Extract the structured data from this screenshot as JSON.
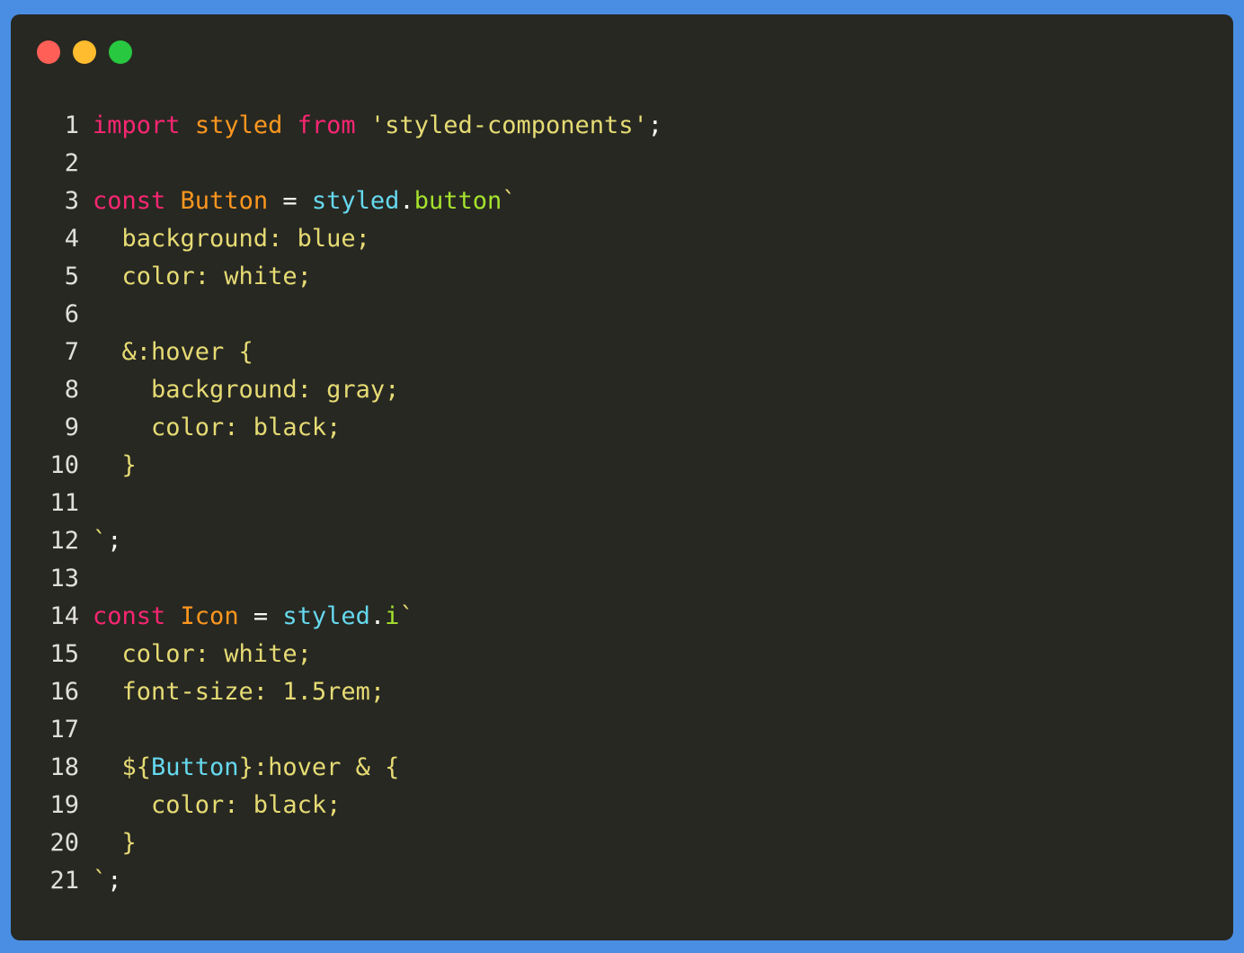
{
  "window": {
    "controls": [
      {
        "name": "close-dot",
        "color": "#ff5f57"
      },
      {
        "name": "minimize-dot",
        "color": "#febc2e"
      },
      {
        "name": "maximize-dot",
        "color": "#28c840"
      }
    ]
  },
  "colors": {
    "background": "#272822",
    "frame": "#4a8ee3",
    "keyword": "#f92672",
    "identifier": "#fd971f",
    "string": "#e6db74",
    "tag": "#66d9ef",
    "function": "#a6e22e",
    "plain": "#f8f8f2"
  },
  "code": {
    "lines": [
      {
        "num": "1",
        "tokens": [
          {
            "t": "import",
            "c": "kw"
          },
          {
            "t": " ",
            "c": "pl"
          },
          {
            "t": "styled",
            "c": "id"
          },
          {
            "t": " ",
            "c": "pl"
          },
          {
            "t": "from",
            "c": "kw"
          },
          {
            "t": " ",
            "c": "pl"
          },
          {
            "t": "'styled-components'",
            "c": "str"
          },
          {
            "t": ";",
            "c": "pl"
          }
        ]
      },
      {
        "num": "2",
        "tokens": []
      },
      {
        "num": "3",
        "tokens": [
          {
            "t": "const",
            "c": "kw"
          },
          {
            "t": " ",
            "c": "pl"
          },
          {
            "t": "Button",
            "c": "id"
          },
          {
            "t": " = ",
            "c": "pl"
          },
          {
            "t": "styled",
            "c": "tag"
          },
          {
            "t": ".",
            "c": "pl"
          },
          {
            "t": "button",
            "c": "fn"
          },
          {
            "t": "`",
            "c": "str"
          }
        ]
      },
      {
        "num": "4",
        "tokens": [
          {
            "t": "  background: blue;",
            "c": "str"
          }
        ]
      },
      {
        "num": "5",
        "tokens": [
          {
            "t": "  color: white;",
            "c": "str"
          }
        ]
      },
      {
        "num": "6",
        "tokens": []
      },
      {
        "num": "7",
        "tokens": [
          {
            "t": "  &:hover {",
            "c": "str"
          }
        ]
      },
      {
        "num": "8",
        "tokens": [
          {
            "t": "    background: gray;",
            "c": "str"
          }
        ]
      },
      {
        "num": "9",
        "tokens": [
          {
            "t": "    color: black;",
            "c": "str"
          }
        ]
      },
      {
        "num": "10",
        "tokens": [
          {
            "t": "  }",
            "c": "str"
          }
        ]
      },
      {
        "num": "11",
        "tokens": []
      },
      {
        "num": "12",
        "tokens": [
          {
            "t": "`",
            "c": "str"
          },
          {
            "t": ";",
            "c": "pl"
          }
        ]
      },
      {
        "num": "13",
        "tokens": []
      },
      {
        "num": "14",
        "tokens": [
          {
            "t": "const",
            "c": "kw"
          },
          {
            "t": " ",
            "c": "pl"
          },
          {
            "t": "Icon",
            "c": "id"
          },
          {
            "t": " = ",
            "c": "pl"
          },
          {
            "t": "styled",
            "c": "tag"
          },
          {
            "t": ".",
            "c": "pl"
          },
          {
            "t": "i",
            "c": "fn"
          },
          {
            "t": "`",
            "c": "str"
          }
        ]
      },
      {
        "num": "15",
        "tokens": [
          {
            "t": "  color: white;",
            "c": "str"
          }
        ]
      },
      {
        "num": "16",
        "tokens": [
          {
            "t": "  font-size: 1.5rem;",
            "c": "str"
          }
        ]
      },
      {
        "num": "17",
        "tokens": []
      },
      {
        "num": "18",
        "tokens": [
          {
            "t": "  ${",
            "c": "str"
          },
          {
            "t": "Button",
            "c": "tag"
          },
          {
            "t": "}:hover & {",
            "c": "str"
          }
        ]
      },
      {
        "num": "19",
        "tokens": [
          {
            "t": "    color: black;",
            "c": "str"
          }
        ]
      },
      {
        "num": "20",
        "tokens": [
          {
            "t": "  }",
            "c": "str"
          }
        ]
      },
      {
        "num": "21",
        "tokens": [
          {
            "t": "`",
            "c": "str"
          },
          {
            "t": ";",
            "c": "pl"
          }
        ]
      }
    ]
  }
}
